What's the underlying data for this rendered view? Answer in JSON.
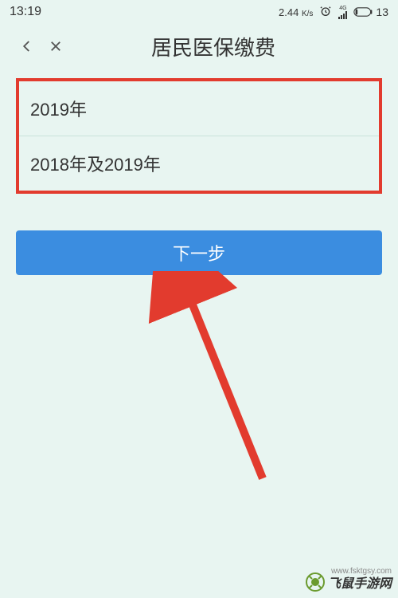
{
  "status_bar": {
    "time": "13:19",
    "speed_value": "2.44",
    "speed_unit": "K/s",
    "network_type": "4G",
    "battery_pct": "13"
  },
  "header": {
    "title": "居民医保缴费"
  },
  "options": {
    "item1": "2019年",
    "item2": "2018年及2019年"
  },
  "button": {
    "next_label": "下一步"
  },
  "watermark": {
    "text": "飞鼠手游网",
    "url": "www.fsktgsy.com"
  }
}
